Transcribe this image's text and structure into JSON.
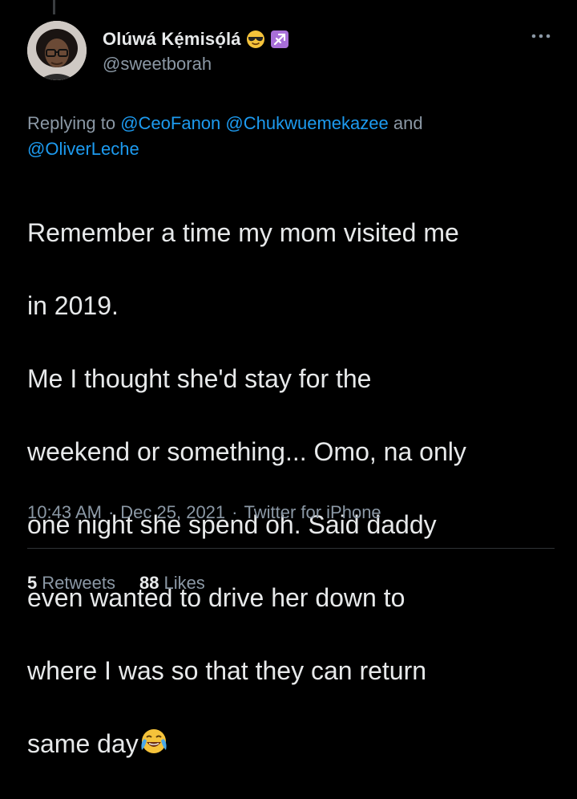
{
  "tweet": {
    "author": {
      "display_name": "Olúwá Kẹ́misọ́lá",
      "handle": "@sweetborah",
      "emojis": [
        "smiling-face-with-sunglasses-emoji",
        "sagittarius-emoji"
      ]
    },
    "replying": {
      "prefix": "Replying to",
      "mentions": [
        "@CeoFanon",
        "@Chukwuemekazee",
        "@OliverLeche"
      ],
      "joiner": "and"
    },
    "text_lines": [
      "Remember a time my mom visited me",
      "in 2019.",
      "Me I thought she'd stay for the",
      "weekend or something... Omo, na only",
      "one night she spend oh. Said daddy",
      "even wanted to drive her down to",
      "where I was so that they can return",
      "same day"
    ],
    "trailing_emoji": "face-with-tears-of-joy-emoji",
    "time": "10:43 AM",
    "separator": "·",
    "date": "Dec 25, 2021",
    "source": "Twitter for iPhone",
    "stats": {
      "retweets_count": "5",
      "retweets_label": "Retweets",
      "likes_count": "88",
      "likes_label": "Likes"
    }
  },
  "colors": {
    "background": "#000000",
    "text": "#e7e9ea",
    "secondary_text": "#8b98a5",
    "link": "#1d9bf0",
    "divider": "#2f3336"
  }
}
